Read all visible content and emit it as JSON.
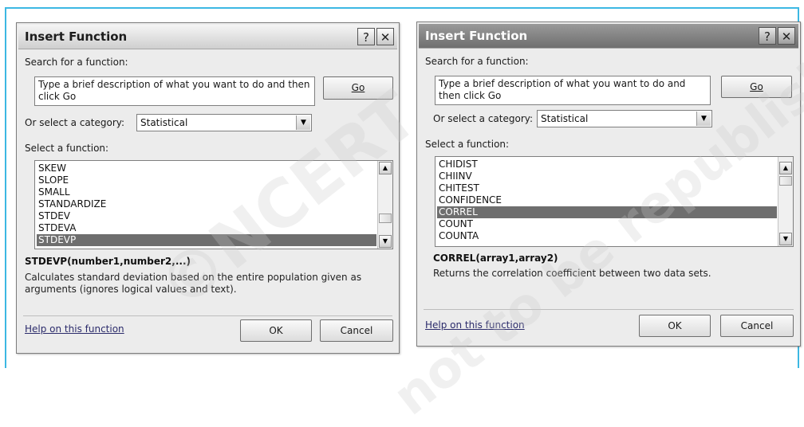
{
  "watermark": {
    "line1": "©NCERT",
    "line2": "not to be republished"
  },
  "dialogs": [
    {
      "title": "Insert Function",
      "help_btn": "?",
      "close_btn": "✕",
      "search_label": "Search for a function:",
      "search_text": "Type a brief description of what you want to do and then click Go",
      "go_label": "Go",
      "category_label": "Or select a category:",
      "category_value": "Statistical",
      "select_label": "Select a function:",
      "functions": [
        "SKEW",
        "SLOPE",
        "SMALL",
        "STANDARDIZE",
        "STDEV",
        "STDEVA",
        "STDEVP"
      ],
      "selected_function": "STDEVP",
      "signature": "STDEVP(number1,number2,...)",
      "description_line1": "Calculates standard deviation based on the entire population given as",
      "description_line2": "arguments (ignores logical values and text).",
      "help_link": "Help on this function",
      "ok_label": "OK",
      "cancel_label": "Cancel"
    },
    {
      "title": "Insert Function",
      "help_btn": "?",
      "close_btn": "✕",
      "search_label": "Search for a function:",
      "search_text": "Type a brief description of what you want to do and then click Go",
      "go_label": "Go",
      "category_label": "Or select a category:",
      "category_value": "Statistical",
      "select_label": "Select a function:",
      "functions": [
        "CHIDIST",
        "CHIINV",
        "CHITEST",
        "CONFIDENCE",
        "CORREL",
        "COUNT",
        "COUNTA"
      ],
      "selected_function": "CORREL",
      "signature": "CORREL(array1,array2)",
      "description_line1": "Returns the correlation coefficient between two data sets.",
      "description_line2": "",
      "help_link": "Help on this function",
      "ok_label": "OK",
      "cancel_label": "Cancel"
    }
  ]
}
